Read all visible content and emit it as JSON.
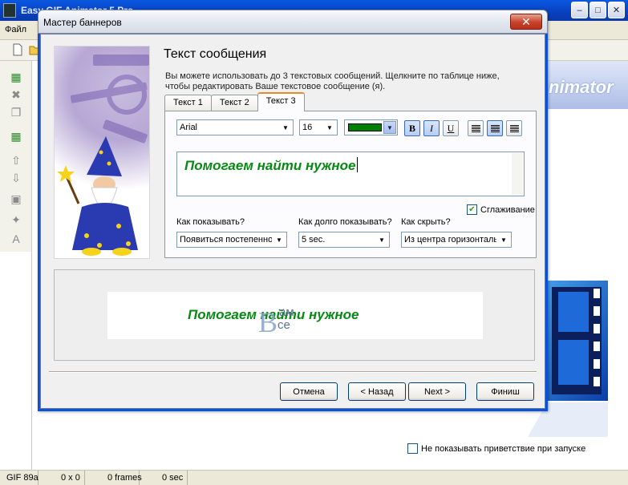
{
  "app": {
    "title": "Easy GIF Animator 5 Pro",
    "menu_file": "Файл",
    "logo_text": "nimator",
    "startup_check_label": "Не показывать приветствие при запуске",
    "status": {
      "format": "GIF 89a",
      "size": "0 x 0",
      "frames": "0 frames",
      "duration": "0 sec"
    }
  },
  "dialog": {
    "title": "Мастер баннеров",
    "page_title": "Текст сообщения",
    "description": "Вы можете использовать до 3 текстовых сообщений. Щелкните по таблице ниже, чтобы редактировать Ваше текстовое сообщение (я).",
    "tabs": [
      {
        "label": "Текст 1",
        "active": false
      },
      {
        "label": "Текст 2",
        "active": false
      },
      {
        "label": "Текст 3",
        "active": true
      }
    ],
    "font": "Arial",
    "font_size": "16",
    "text_color": "#008000",
    "bold_label": "B",
    "italic_label": "I",
    "underline_label": "U",
    "message_text": "Помогаем найти нужное",
    "smoothing_label": "Сглаживание",
    "smoothing_checked": true,
    "show_label": "Как показывать?",
    "show_value": "Появиться постепенно",
    "duration_label": "Как долго показывать?",
    "duration_value": "5 sec.",
    "hide_label": "Как скрыть?",
    "hide_value": "Из центра горизонтально",
    "preview_text": "Помогаем найти нужное",
    "watermark": {
      "top": "ам",
      "bottom": "се",
      "big": "В"
    },
    "buttons": {
      "cancel": "Отмена",
      "back": "< Назад",
      "next": "Next >",
      "finish": "Финиш"
    }
  }
}
